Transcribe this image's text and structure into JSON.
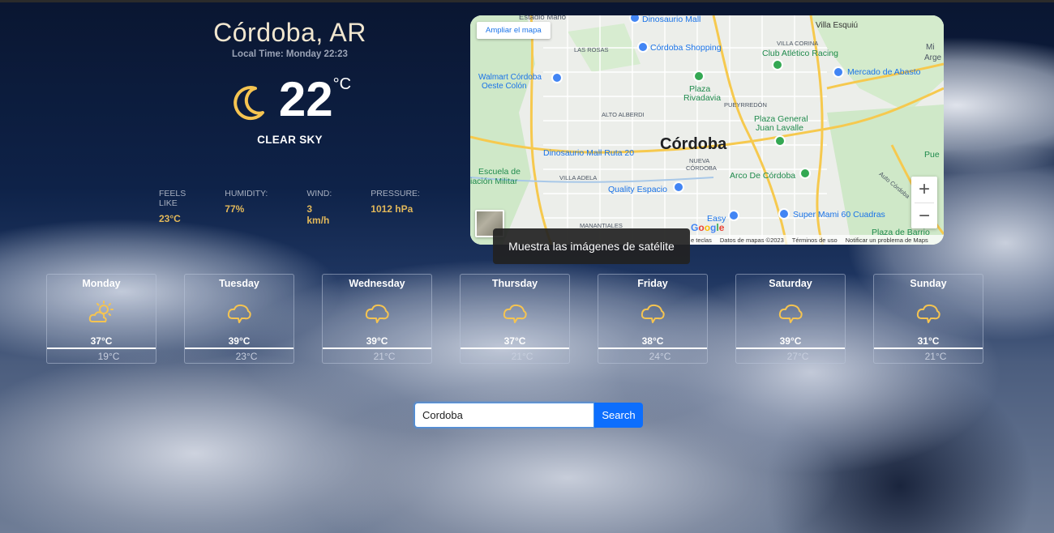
{
  "current": {
    "city": "Córdoba, AR",
    "local_time": "Local Time: Monday 22:23",
    "temperature": "22",
    "unit": "°C",
    "description": "CLEAR SKY",
    "icon": "moon-icon",
    "stats": [
      {
        "label": "FEELS LIKE",
        "value": "23°C"
      },
      {
        "label": "HUMIDITY:",
        "value": "77%"
      },
      {
        "label": "WIND:",
        "value": "3 km/h"
      },
      {
        "label": "PRESSURE:",
        "value": "1012 hPa"
      }
    ]
  },
  "map": {
    "expand_label": "Ampliar el mapa",
    "city_label": "Córdoba",
    "zoom_in": "+",
    "zoom_out": "−",
    "google": "Google",
    "labels": {
      "estadio": "Estadio Mario",
      "dinosaurio_mall": "Dinosaurio Mall",
      "villa_esquiu": "Villa Esquiú",
      "las_rosas": "LAS ROSAS",
      "villa_corina": "VILLA CORINA",
      "cordoba_shopping": "Córdoba Shopping",
      "club_racing": "Club Atlético Racing",
      "walmart": "Walmart Córdoba",
      "walmart2": "Oeste Colón",
      "mercado": "Mercado de Abasto",
      "plaza_rivadavia": "Plaza",
      "plaza_rivadavia2": "Rivadavia",
      "alto_alberdi": "ALTO ALBERDI",
      "pueyrredon": "PUEYRREDÓN",
      "plaza_general": "Plaza General",
      "plaza_general2": "Juan Lavalle",
      "dinosaurio_ruta": "Dinosaurio Mall Ruta 20",
      "nueva_cordoba": "NUEVA",
      "nueva_cordoba2": "CÓRDOBA",
      "escuela": "Escuela de",
      "escuela2": "iación Militar",
      "villa_adela": "VILLA ADELA",
      "arco": "Arco De Córdoba",
      "quality": "Quality Espacio",
      "easy": "Easy",
      "super_mami": "Super Mami 60 Cuadras",
      "manantiales": "MANANTIALES",
      "plaza_barrio": "Plaza de Barrio",
      "pue": "Pue",
      "arge": "Arge",
      "mi": "Mi",
      "autopista": "Auto Córdoba"
    },
    "attribution": [
      "e teclas",
      "Datos de mapas ©2023",
      "Términos de uso",
      "Notificar un problema de Maps"
    ]
  },
  "tooltip": "Muestra las imágenes de satélite",
  "forecast": [
    {
      "day": "Monday",
      "max": "37°C",
      "min": "19°C",
      "icon": "partly-cloudy-icon"
    },
    {
      "day": "Tuesday",
      "max": "39°C",
      "min": "23°C",
      "icon": "cloud-icon"
    },
    {
      "day": "Wednesday",
      "max": "39°C",
      "min": "21°C",
      "icon": "cloud-icon"
    },
    {
      "day": "Thursday",
      "max": "37°C",
      "min": "21°C",
      "icon": "cloud-icon"
    },
    {
      "day": "Friday",
      "max": "38°C",
      "min": "24°C",
      "icon": "cloud-icon"
    },
    {
      "day": "Saturday",
      "max": "39°C",
      "min": "27°C",
      "icon": "cloud-icon"
    },
    {
      "day": "Sunday",
      "max": "31°C",
      "min": "21°C",
      "icon": "cloud-icon"
    }
  ],
  "search": {
    "value": "Cordoba",
    "button": "Search"
  },
  "colors": {
    "accent": "#e2b85a",
    "button": "#0d6efd",
    "icon": "#f5c451"
  }
}
